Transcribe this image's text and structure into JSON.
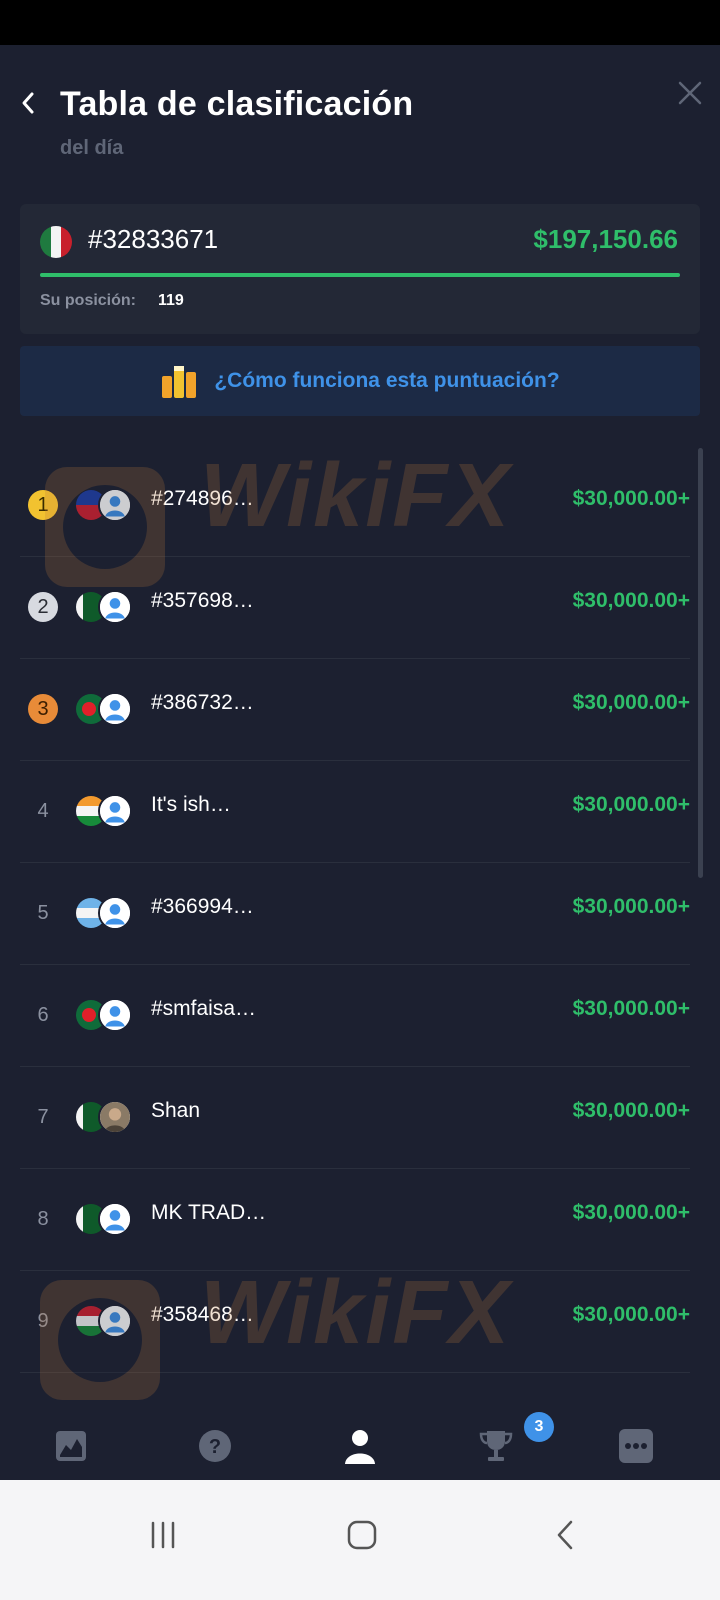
{
  "header": {
    "title": "Tabla de clasificación",
    "subtitle": "del día"
  },
  "my_card": {
    "id": "#32833671",
    "amount": "$197,150.66",
    "position_label": "Su posición:",
    "position_value": "119"
  },
  "banner": {
    "text": "¿Cómo funciona esta puntuación?"
  },
  "leaderboard": [
    {
      "rank": "1",
      "name": "#274896…",
      "amount": "$30,000.00+"
    },
    {
      "rank": "2",
      "name": "#357698…",
      "amount": "$30,000.00+"
    },
    {
      "rank": "3",
      "name": "#386732…",
      "amount": "$30,000.00+"
    },
    {
      "rank": "4",
      "name": "It's ish…",
      "amount": "$30,000.00+"
    },
    {
      "rank": "5",
      "name": "#366994…",
      "amount": "$30,000.00+"
    },
    {
      "rank": "6",
      "name": "#smfaisa…",
      "amount": "$30,000.00+"
    },
    {
      "rank": "7",
      "name": "Shan",
      "amount": "$30,000.00+"
    },
    {
      "rank": "8",
      "name": "MK TRAD…",
      "amount": "$30,000.00+"
    },
    {
      "rank": "9",
      "name": "#358468…",
      "amount": "$30,000.00+"
    }
  ],
  "tabs": {
    "trophy_badge": "3"
  },
  "watermark": {
    "text": "WikiFX"
  },
  "colors": {
    "background": "#1c2030",
    "accent_green": "#2fbe6a",
    "accent_blue": "#3f92e8"
  }
}
